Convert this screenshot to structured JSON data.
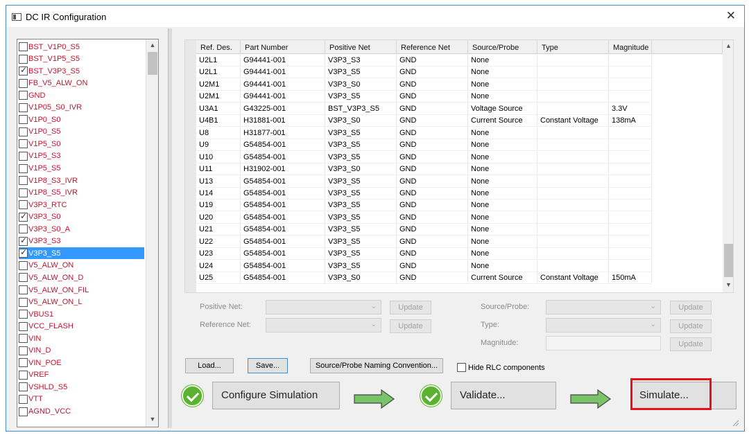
{
  "window": {
    "title": "DC IR Configuration",
    "close_glyph": "✕"
  },
  "net_list": {
    "items": [
      {
        "label": "BST_V1P0_S5",
        "checked": false
      },
      {
        "label": "BST_V1P5_S5",
        "checked": false
      },
      {
        "label": "BST_V3P3_S5",
        "checked": true
      },
      {
        "label": "FB_V5_ALW_ON",
        "checked": false
      },
      {
        "label": "GND",
        "checked": false
      },
      {
        "label": "V1P05_S0_IVR",
        "checked": false
      },
      {
        "label": "V1P0_S0",
        "checked": false
      },
      {
        "label": "V1P0_S5",
        "checked": false
      },
      {
        "label": "V1P5_S0",
        "checked": false
      },
      {
        "label": "V1P5_S3",
        "checked": false
      },
      {
        "label": "V1P5_S5",
        "checked": false
      },
      {
        "label": "V1P8_S3_IVR",
        "checked": false
      },
      {
        "label": "V1P8_S5_IVR",
        "checked": false
      },
      {
        "label": "V3P3_RTC",
        "checked": false
      },
      {
        "label": "V3P3_S0",
        "checked": true
      },
      {
        "label": "V3P3_S0_A",
        "checked": false
      },
      {
        "label": "V3P3_S3",
        "checked": true
      },
      {
        "label": "V3P3_S5",
        "checked": true,
        "selected": true
      },
      {
        "label": "V5_ALW_ON",
        "checked": false
      },
      {
        "label": "V5_ALW_ON_D",
        "checked": false
      },
      {
        "label": "V5_ALW_ON_FIL",
        "checked": false
      },
      {
        "label": "V5_ALW_ON_L",
        "checked": false
      },
      {
        "label": "VBUS1",
        "checked": false
      },
      {
        "label": "VCC_FLASH",
        "checked": false
      },
      {
        "label": "VIN",
        "checked": false
      },
      {
        "label": "VIN_D",
        "checked": false
      },
      {
        "label": "VIN_POE",
        "checked": false
      },
      {
        "label": "VREF",
        "checked": false
      },
      {
        "label": "VSHLD_S5",
        "checked": false
      },
      {
        "label": "VTT",
        "checked": false
      },
      {
        "label": "AGND_VCC",
        "checked": false
      }
    ],
    "scroll_up": "▲",
    "scroll_down": "▼"
  },
  "table": {
    "columns": [
      "Ref. Des.",
      "Part Number",
      "Positive Net",
      "Reference Net",
      "Source/Probe",
      "Type",
      "Magnitude"
    ],
    "rows": [
      [
        "U2L1",
        "G94441-001",
        "V3P3_S3",
        "GND",
        "None",
        "",
        ""
      ],
      [
        "U2L1",
        "G94441-001",
        "V3P3_S5",
        "GND",
        "None",
        "",
        ""
      ],
      [
        "U2M1",
        "G94441-001",
        "V3P3_S0",
        "GND",
        "None",
        "",
        ""
      ],
      [
        "U2M1",
        "G94441-001",
        "V3P3_S5",
        "GND",
        "None",
        "",
        ""
      ],
      [
        "U3A1",
        "G43225-001",
        "BST_V3P3_S5",
        "GND",
        "Voltage Source",
        "",
        "3.3V"
      ],
      [
        "U4B1",
        "H31881-001",
        "V3P3_S0",
        "GND",
        "Current Source",
        "Constant Voltage",
        "138mA"
      ],
      [
        "U8",
        "H31877-001",
        "V3P3_S5",
        "GND",
        "None",
        "",
        ""
      ],
      [
        "U9",
        "G54854-001",
        "V3P3_S5",
        "GND",
        "None",
        "",
        ""
      ],
      [
        "U10",
        "G54854-001",
        "V3P3_S5",
        "GND",
        "None",
        "",
        ""
      ],
      [
        "U11",
        "H31902-001",
        "V3P3_S0",
        "GND",
        "None",
        "",
        ""
      ],
      [
        "U13",
        "G54854-001",
        "V3P3_S5",
        "GND",
        "None",
        "",
        ""
      ],
      [
        "U14",
        "G54854-001",
        "V3P3_S5",
        "GND",
        "None",
        "",
        ""
      ],
      [
        "U19",
        "G54854-001",
        "V3P3_S5",
        "GND",
        "None",
        "",
        ""
      ],
      [
        "U20",
        "G54854-001",
        "V3P3_S5",
        "GND",
        "None",
        "",
        ""
      ],
      [
        "U21",
        "G54854-001",
        "V3P3_S5",
        "GND",
        "None",
        "",
        ""
      ],
      [
        "U22",
        "G54854-001",
        "V3P3_S5",
        "GND",
        "None",
        "",
        ""
      ],
      [
        "U23",
        "G54854-001",
        "V3P3_S5",
        "GND",
        "None",
        "",
        ""
      ],
      [
        "U24",
        "G54854-001",
        "V3P3_S5",
        "GND",
        "None",
        "",
        ""
      ],
      [
        "U25",
        "G54854-001",
        "V3P3_S0",
        "GND",
        "Current Source",
        "Constant Voltage",
        "150mA"
      ]
    ],
    "scroll_up": "▲",
    "scroll_down": "▼"
  },
  "form": {
    "positive_net_label": "Positive Net:",
    "reference_net_label": "Reference Net:",
    "source_probe_label": "Source/Probe:",
    "type_label": "Type:",
    "magnitude_label": "Magnitude:",
    "update_label": "Update",
    "combo_arrow": "⌄"
  },
  "actions": {
    "load_label": "Load...",
    "save_label": "Save...",
    "naming_label": "Source/Probe Naming Convention...",
    "hide_rlc_label": "Hide RLC components",
    "hide_rlc_checked": false
  },
  "workflow": {
    "configure_label": "Configure Simulation",
    "validate_label": "Validate...",
    "simulate_label": "Simulate...",
    "check_color": "#5ab230",
    "arrow_color": "#7ac36a",
    "highlight_color": "#e8101a"
  }
}
